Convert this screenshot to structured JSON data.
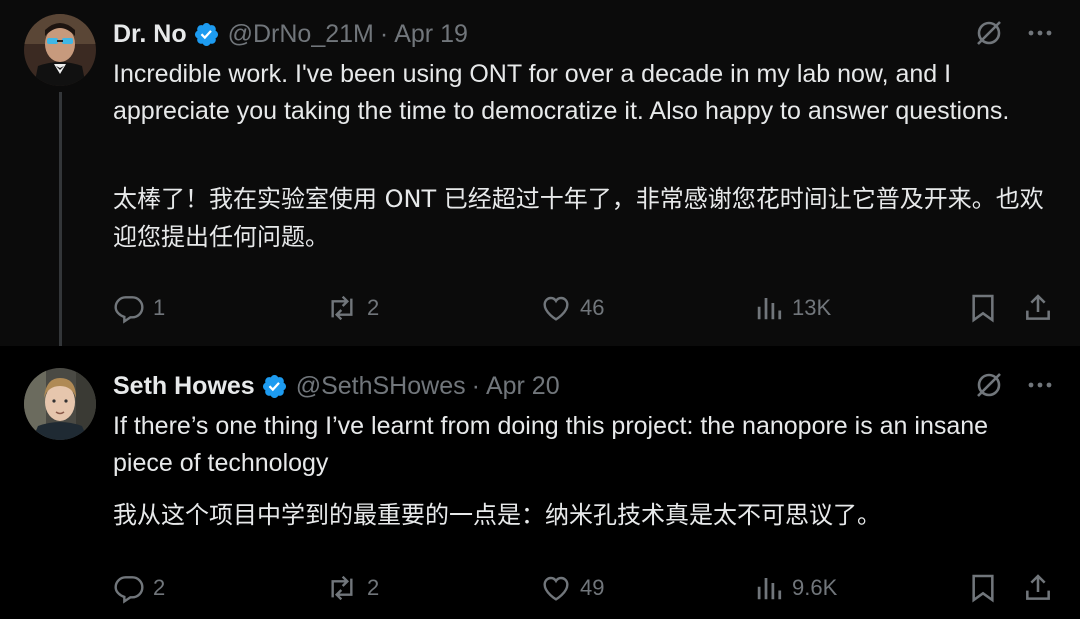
{
  "tweets": [
    {
      "name": "Dr. No",
      "handle": "@DrNo_21M",
      "separator": "·",
      "date": "Apr 19",
      "text_en": "Incredible work. I've been using ONT for over a decade in my lab now, and I appreciate you taking the time to democratize it. Also happy to answer questions.",
      "text_zh": "太棒了！我在实验室使用 ONT 已经超过十年了，非常感谢您花时间让它普及开来。也欢迎您提出任何问题。",
      "replies": "1",
      "reposts": "2",
      "likes": "46",
      "views": "13K"
    },
    {
      "name": "Seth Howes",
      "handle": "@SethSHowes",
      "separator": "·",
      "date": "Apr 20",
      "text_en": "If there’s one thing I’ve learnt from doing this project: the nanopore is an insane piece of technology",
      "text_zh": "我从这个项目中学到的最重要的一点是：纳米孔技术真是太不可思议了。",
      "replies": "2",
      "reposts": "2",
      "likes": "49",
      "views": "9.6K"
    }
  ],
  "colors": {
    "background": "#000000",
    "primary_text": "#e7e9ea",
    "secondary_text": "#71767b",
    "verified_badge": "#1d9bf0"
  },
  "icons": [
    "verified-badge-icon",
    "grok-icon",
    "more-icon",
    "reply-icon",
    "repost-icon",
    "like-icon",
    "views-icon",
    "bookmark-icon",
    "share-icon"
  ]
}
